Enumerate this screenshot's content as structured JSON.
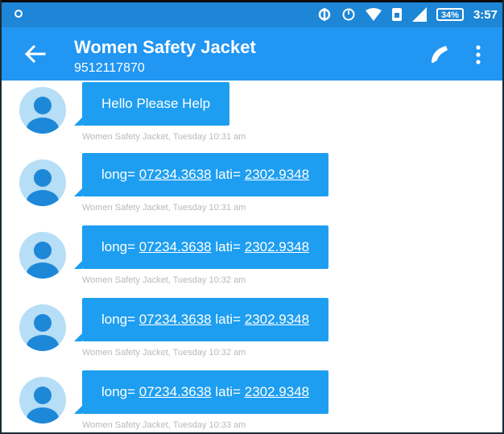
{
  "status_bar": {
    "time": "3:57",
    "battery": "34%"
  },
  "header": {
    "title": "Women Safety Jacket",
    "subtitle": "9512117870"
  },
  "messages": [
    {
      "text": "Hello Please Help",
      "meta": "Women Safety Jacket, Tuesday 10:31 am"
    },
    {
      "prefix": "long= ",
      "long": "07234.3638",
      "mid": " lati= ",
      "lati": "2302.9348",
      "meta": "Women Safety Jacket, Tuesday 10:31 am"
    },
    {
      "prefix": "long= ",
      "long": "07234.3638",
      "mid": " lati= ",
      "lati": "2302.9348",
      "meta": "Women Safety Jacket, Tuesday 10:32 am"
    },
    {
      "prefix": "long= ",
      "long": "07234.3638",
      "mid": " lati= ",
      "lati": "2302.9348",
      "meta": "Women Safety Jacket, Tuesday 10:32 am"
    },
    {
      "prefix": "long= ",
      "long": "07234.3638",
      "mid": " lati= ",
      "lati": "2302.9348",
      "meta": "Women Safety Jacket, Tuesday 10:33 am"
    }
  ],
  "icons": {
    "back": "arrow-back-icon",
    "call": "phone-icon",
    "more": "more-vert-icon",
    "avatar": "person-avatar-icon"
  },
  "colors": {
    "status_bar": "#1d86d6",
    "app_bar": "#2196f3",
    "bubble": "#1e9ef0",
    "avatar_bg": "#b6def6",
    "avatar_fg": "#1e88d8",
    "meta_text": "#b9b9b9"
  }
}
